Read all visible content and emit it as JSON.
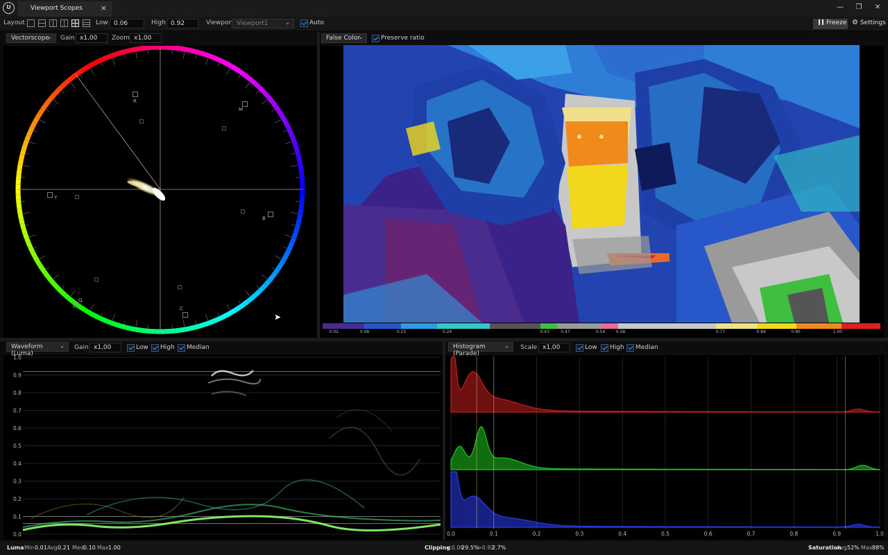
{
  "window": {
    "tab_title": "Viewport Scopes",
    "tab_close": "×",
    "app_icon": "U",
    "minimize": "—",
    "restore": "❐",
    "close": "✕"
  },
  "toolbar": {
    "layout_label": "Layout",
    "low_label": "Low",
    "low_value": "0.06",
    "high_label": "High",
    "high_value": "0.92",
    "viewport_label": "Viewport",
    "viewport_value": "Viewport1",
    "auto_label": "Auto",
    "freeze_label": "Freeze",
    "settings_label": "Settings"
  },
  "vectorscope": {
    "mode": "Vectorscope",
    "gain_label": "Gain",
    "gain_value": "x1,00",
    "zoom_label": "Zoom",
    "zoom_value": "x1,00",
    "targets": [
      "R",
      "M",
      "B",
      "C",
      "G",
      "Y"
    ]
  },
  "false_color": {
    "mode": "False Color",
    "preserve_label": "Preserve ratio",
    "legend_ticks": [
      "0.02",
      "0.08",
      "0.15",
      "0.24",
      "0.43",
      "0.47",
      "0.54",
      "0.58",
      "0.77",
      "0.84",
      "0.90",
      "1.00"
    ],
    "legend_colors": [
      "#4a2c8f",
      "#2757c8",
      "#2c9ee0",
      "#32c8c8",
      "#555555",
      "#3fbf3f",
      "#9a9a9a",
      "#e86aa0",
      "#c8c8c8",
      "#f0e08a",
      "#f2d81c",
      "#f08a1a",
      "#e02020"
    ]
  },
  "waveform": {
    "mode": "Waveform (Luma)",
    "gain_label": "Gain",
    "gain_value": "x1,00",
    "low_label": "Low",
    "high_label": "High",
    "median_label": "Median",
    "y_ticks": [
      "1.0",
      "0.9",
      "0.8",
      "0.7",
      "0.6",
      "0.5",
      "0.4",
      "0.3",
      "0.2",
      "0.1",
      "0.0"
    ]
  },
  "histogram": {
    "mode": "Histogram (Parade)",
    "scale_label": "Scale",
    "scale_value": "x1,00",
    "low_label": "Low",
    "high_label": "High",
    "median_label": "Median",
    "x_ticks": [
      "0.0",
      "0.1",
      "0.2",
      "0.3",
      "0.4",
      "0.5",
      "0.6",
      "0.7",
      "0.8",
      "0.9",
      "1.0"
    ],
    "channel_colors": {
      "red": "#c81e1e",
      "green": "#1ec81e",
      "blue": "#2a3cf0"
    }
  },
  "status": {
    "luma_label": "Luma",
    "min_label": "Min",
    "min_value": "0.01",
    "avg_label": "Avg",
    "avg_value": "0.21",
    "med_label": "Med",
    "med_value": "0.10",
    "max_label": "Max",
    "max_value": "1.00",
    "clipping_label": "Clipping",
    "clip_low_label": "<0.06",
    "clip_low_value": "29.5%",
    "clip_high_label": ">0.92",
    "clip_high_value": "2.7%",
    "saturation_label": "Saturation",
    "sat_avg_label": "Avg",
    "sat_avg_value": "52%",
    "sat_max_label": "Max",
    "sat_max_value": "88%"
  }
}
